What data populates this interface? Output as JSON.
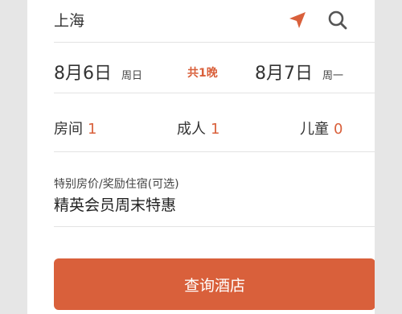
{
  "colors": {
    "accent": "#d9603b",
    "text": "#333333",
    "divider": "#e3e3e3"
  },
  "destination": {
    "city": "上海",
    "locate_icon": "location-arrow-icon",
    "search_icon": "search-icon"
  },
  "dates": {
    "checkin_date": "8月6日",
    "checkin_weekday": "周日",
    "nights": "共1晚",
    "checkout_date": "8月7日",
    "checkout_weekday": "周一"
  },
  "guests": {
    "rooms_label": "房间",
    "rooms_value": "1",
    "adults_label": "成人",
    "adults_value": "1",
    "children_label": "儿童",
    "children_value": "0"
  },
  "special_rate": {
    "label": "特别房价/奖励住宿(可选)",
    "value": "精英会员周末特惠"
  },
  "submit": {
    "label": "查询酒店"
  }
}
